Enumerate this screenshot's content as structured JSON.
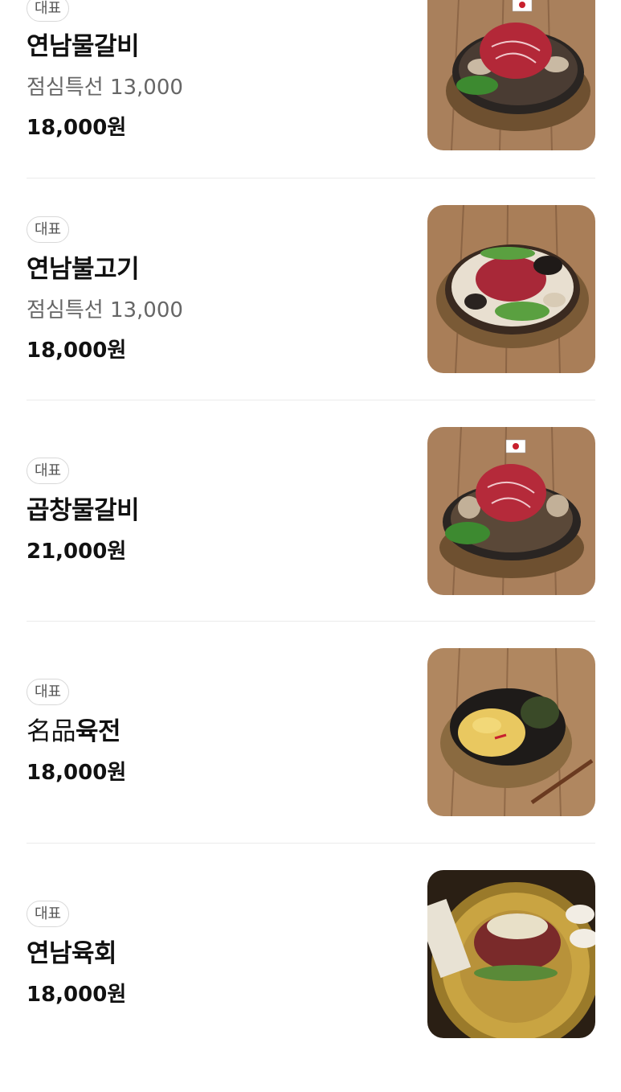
{
  "menu": {
    "items": [
      {
        "badge": "대표",
        "name": "연남물갈비",
        "description": "점심특선 13,000",
        "price": "18,000원",
        "photo": "galbi-hotpot-photo"
      },
      {
        "badge": "대표",
        "name": "연남불고기",
        "description": "점심특선 13,000",
        "price": "18,000원",
        "photo": "bulgogi-hotpot-photo"
      },
      {
        "badge": "대표",
        "name": "곱창물갈비",
        "price": "21,000원",
        "photo": "gopchang-galbi-photo"
      },
      {
        "badge": "대표",
        "name_prefix": "名品",
        "name_suffix": "육전",
        "price": "18,000원",
        "photo": "yukjeon-photo"
      },
      {
        "badge": "대표",
        "name": "연남육회",
        "price": "18,000원",
        "photo": "yukhoe-photo"
      }
    ]
  },
  "colors": {
    "background": "#ffffff",
    "text": "#111111",
    "muted_text": "#666666",
    "divider": "#ebebeb",
    "badge_border": "#d8d8d8"
  }
}
